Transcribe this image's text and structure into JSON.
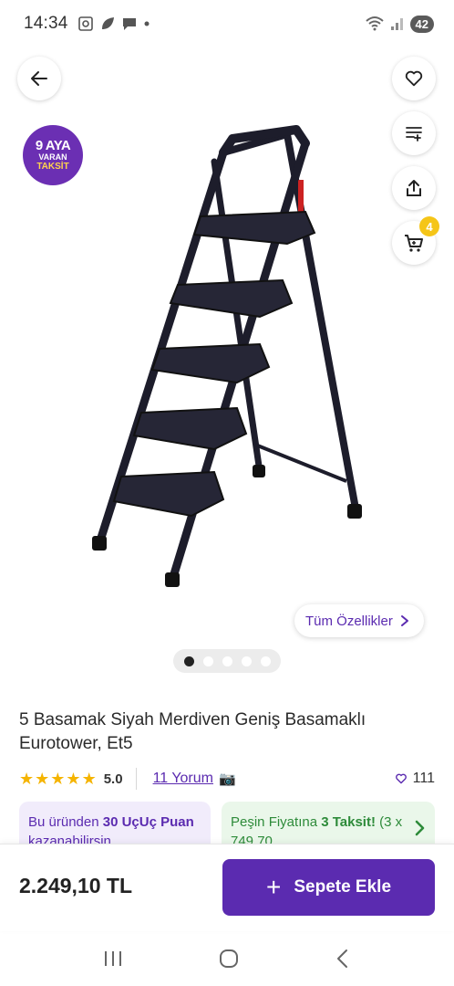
{
  "status_bar": {
    "time": "14:34",
    "battery": "42"
  },
  "gallery": {
    "taksit_badge": {
      "line1": "9 AYA",
      "line2": "VARAN",
      "line3": "TAKSİT"
    },
    "features_label": "Tüm Özellikler",
    "cart_count": "4",
    "dots_total": 5,
    "dots_active": 1
  },
  "product": {
    "title": "5 Basamak Siyah Merdiven Geniş Basamaklı Eurotower, Et5",
    "rating": "5.0",
    "reviews": "11 Yorum",
    "likes": "111"
  },
  "info_cards": {
    "left_pre": "Bu üründen ",
    "left_bold": "30 UçUç Puan",
    "left_post": " kazanabilirsin",
    "right_pre": "Peşin Fiyatına ",
    "right_bold": "3 Taksit!",
    "right_post": " (3 x 749,70"
  },
  "bottom_bar": {
    "price": "2.249,10 TL",
    "add_to_cart": "Sepete Ekle"
  },
  "colors": {
    "brand_purple": "#5b2bb0",
    "badge_yellow": "#f5c518",
    "star": "#f5b400",
    "green": "#2e8b3a"
  },
  "icons": [
    "back-arrow-icon",
    "heart-icon",
    "filter-add-icon",
    "share-icon",
    "cart-icon",
    "chevron-right-icon",
    "camera-icon",
    "recents-icon",
    "home-icon",
    "back-nav-icon"
  ]
}
